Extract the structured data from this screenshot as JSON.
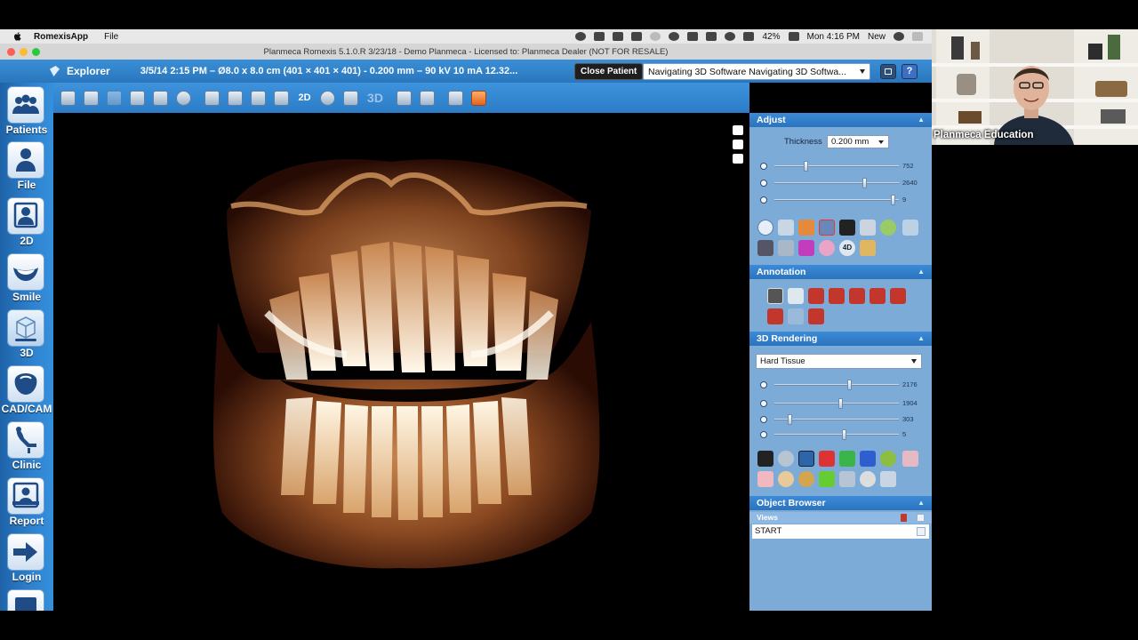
{
  "menubar": {
    "app_name": "RomexisApp",
    "menu_file": "File",
    "battery": "42%",
    "clock": "Mon 4:16 PM",
    "new_label": "New"
  },
  "window": {
    "title": "Planmeca Romexis 5.1.0.R  3/23/18 - Demo Planmeca - Licensed to: Planmeca Dealer (NOT FOR RESALE)"
  },
  "header": {
    "module": "Explorer",
    "scan_info": "3/5/14 2:15 PM – Ø8.0 x 8.0 cm (401 × 401 × 401) - 0.200 mm – 90 kV 10 mA 12.32...",
    "close_patient": "Close Patient",
    "study_select": "Navigating 3D Software Navigating 3D Softwa..."
  },
  "nav": {
    "items": [
      {
        "label": "Patients",
        "icon": "patients-icon"
      },
      {
        "label": "File",
        "icon": "file-icon"
      },
      {
        "label": "2D",
        "icon": "2d-icon"
      },
      {
        "label": "Smile",
        "icon": "smile-icon"
      },
      {
        "label": "3D",
        "icon": "3d-icon"
      },
      {
        "label": "CAD/CAM",
        "icon": "cadcam-icon"
      },
      {
        "label": "Clinic",
        "icon": "clinic-icon"
      },
      {
        "label": "Report",
        "icon": "report-icon"
      },
      {
        "label": "Login",
        "icon": "login-icon"
      }
    ]
  },
  "toolbar": {
    "mode_2d": "2D",
    "mode_3d": "3D"
  },
  "adjust": {
    "title": "Adjust",
    "thickness_label": "Thickness",
    "thickness_value": "0.200 mm",
    "sliders": [
      {
        "icon": "contrast-icon",
        "value": "752",
        "level": 0.25
      },
      {
        "icon": "brightness-icon",
        "value": "2640",
        "level": 0.72
      },
      {
        "icon": "gamma-icon",
        "value": "9",
        "level": 0.95
      }
    ]
  },
  "annotation": {
    "title": "Annotation"
  },
  "rendering": {
    "title": "3D Rendering",
    "preset": "Hard Tissue",
    "sliders": [
      {
        "icon": "contrast-icon",
        "value": "2176",
        "level": 0.6
      },
      {
        "icon": "brightness-icon",
        "value": "1904",
        "level": 0.53
      },
      {
        "icon": "threshold-icon",
        "value": "303",
        "level": 0.12
      },
      {
        "icon": "opacity-icon",
        "value": "5",
        "level": 0.56
      }
    ]
  },
  "object_browser": {
    "title": "Object Browser",
    "views_label": "Views",
    "rows": [
      "START"
    ]
  },
  "webcam": {
    "label": "Planmeca Education"
  },
  "colors": {
    "app_blue": "#2c7cc7",
    "panel_blue": "#7dabd8",
    "bone": "#f3d7b0"
  }
}
